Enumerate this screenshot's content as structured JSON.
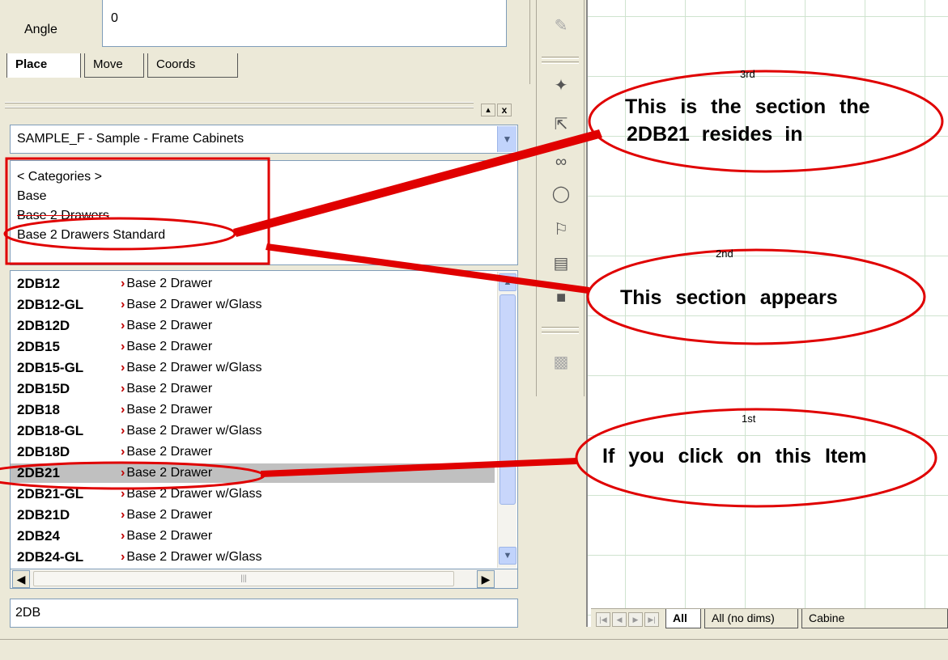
{
  "properties": {
    "angle_label": "Angle",
    "angle_value": "0",
    "tabs": [
      "Place",
      "Move",
      "Coords"
    ],
    "active_tab": "Place"
  },
  "library": {
    "pin": "▴",
    "close": "x",
    "selected": "SAMPLE_F - Sample - Frame Cabinets",
    "categories": [
      "< Categories >",
      "Base",
      "Base 2 Drawers",
      "Base 2 Drawers Standard"
    ],
    "items": [
      {
        "code": "2DB12",
        "desc": "Base 2 Drawer"
      },
      {
        "code": "2DB12-GL",
        "desc": "Base 2 Drawer w/Glass"
      },
      {
        "code": "2DB12D",
        "desc": "Base 2 Drawer"
      },
      {
        "code": "2DB15",
        "desc": "Base 2 Drawer"
      },
      {
        "code": "2DB15-GL",
        "desc": "Base 2 Drawer w/Glass"
      },
      {
        "code": "2DB15D",
        "desc": "Base 2 Drawer"
      },
      {
        "code": "2DB18",
        "desc": "Base 2 Drawer"
      },
      {
        "code": "2DB18-GL",
        "desc": "Base 2 Drawer w/Glass"
      },
      {
        "code": "2DB18D",
        "desc": "Base 2 Drawer"
      },
      {
        "code": "2DB21",
        "desc": "Base 2 Drawer"
      },
      {
        "code": "2DB21-GL",
        "desc": "Base 2 Drawer w/Glass"
      },
      {
        "code": "2DB21D",
        "desc": "Base 2 Drawer"
      },
      {
        "code": "2DB24",
        "desc": "Base 2 Drawer"
      },
      {
        "code": "2DB24-GL",
        "desc": "Base 2 Drawer w/Glass"
      }
    ],
    "selected_item": "2DB21",
    "search_value": "2DB"
  },
  "drawing_tabs": [
    "All",
    "All (no dims)",
    "Cabine"
  ],
  "active_drawing_tab": "All",
  "annotations": {
    "first_num": "1st",
    "first_text": "If you click on this Item",
    "second_num": "2nd",
    "second_text": "This section appears",
    "third_num": "3rd",
    "third_text_1": "This is the section the",
    "third_text_2": "2DB21 resides in"
  },
  "colors": {
    "annotation": "#e00000",
    "selection": "#c0c0c0"
  }
}
